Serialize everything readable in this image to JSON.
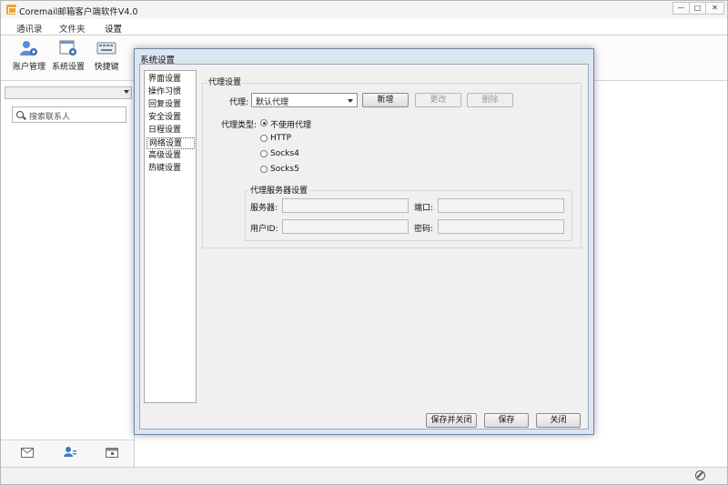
{
  "app": {
    "title": "Coremail邮箱客户端软件V4.0",
    "min_glyph": "—",
    "max_glyph": "□",
    "close_glyph": "✕"
  },
  "menu_tabs": [
    "通讯录",
    "文件夹",
    "设置"
  ],
  "ribbon": {
    "account": "账户管理",
    "system": "系统设置",
    "shortcut": "快捷键"
  },
  "search": {
    "placeholder": "搜索联系人"
  },
  "dialog": {
    "title": "系统设置",
    "nav_items": [
      "界面设置",
      "操作习惯",
      "回复设置",
      "安全设置",
      "日程设置",
      "网络设置",
      "高级设置",
      "热键设置"
    ],
    "selected_nav": "网络设置",
    "proxy_group": "代理设置",
    "proxy_label": "代理:",
    "proxy_value": "默认代理",
    "btn_new": "新增",
    "btn_edit": "更改",
    "btn_delete": "删除",
    "proxy_type_label": "代理类型:",
    "proxy_types": [
      "不使用代理",
      "HTTP",
      "Socks4",
      "Socks5"
    ],
    "server_group": "代理服务器设置",
    "server_label": "服务器:",
    "port_label": "端口:",
    "userid_label": "用户ID:",
    "password_label": "密码:",
    "btn_save_close": "保存并关闭",
    "btn_save": "保存",
    "btn_close": "关闭"
  }
}
